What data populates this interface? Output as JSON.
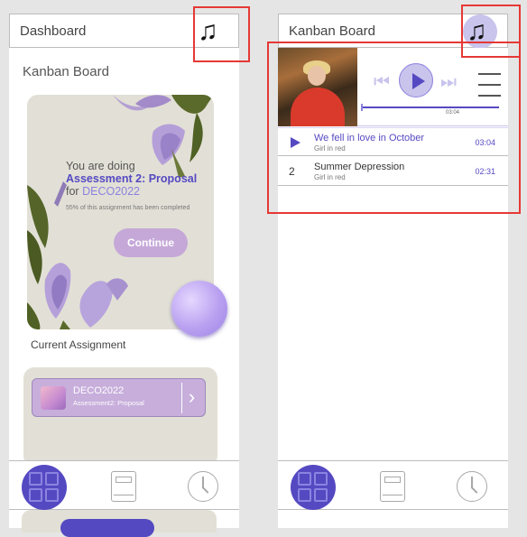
{
  "left": {
    "topbar": {
      "title": "Dashboard",
      "icon": "music-note-icon"
    },
    "section_title": "Kanban Board",
    "assignment_card": {
      "line1": "You are doing",
      "assessment": "Assessment 2: Proposal",
      "for_word": "for",
      "course": "DECO2022",
      "progress_note": "55% of this assignment has been completed",
      "progress_percent": 55,
      "continue_label": "Continue"
    },
    "current_label": "Current Assignment",
    "course_pill": {
      "name": "DECO2022",
      "sub": "Assessment2: Proposal",
      "chevron": "›"
    }
  },
  "right": {
    "topbar": {
      "title": "Kanban Board",
      "icon": "music-note-icon"
    },
    "player": {
      "time": "03:04"
    },
    "songs": [
      {
        "index": "1",
        "title": "We fell in love in October",
        "artist": "Girl in red",
        "duration": "03:04",
        "playing": true
      },
      {
        "index": "2",
        "title": "Summer Depression",
        "artist": "Girl in red",
        "duration": "02:31",
        "playing": false
      }
    ]
  },
  "bottom_nav": {
    "items": [
      "grid-icon",
      "book-icon",
      "clock-icon"
    ]
  },
  "colors": {
    "accent": "#5549c2",
    "highlight": "#e53935",
    "card": "#e2e0d6",
    "lilac": "#c5a8d8"
  }
}
